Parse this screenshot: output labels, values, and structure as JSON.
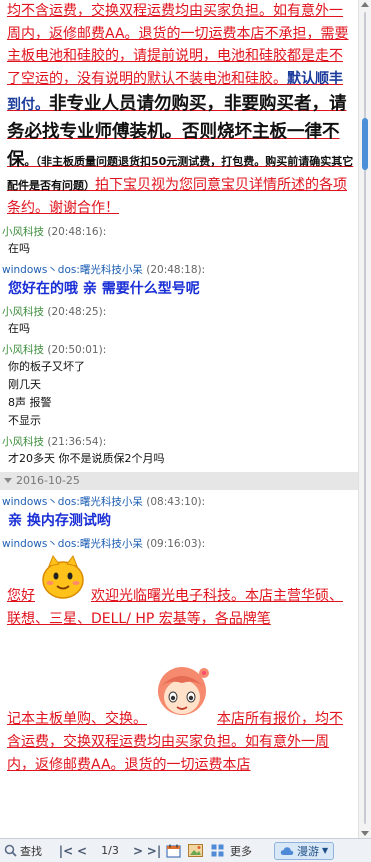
{
  "notice": {
    "p1": "均不含运费，交换双程运费均由买家负担。如有意外一周内，返修邮费AA。退货的一切运费本店不承担，需要主板电池和硅胶的，请提前说明，电池和硅胶都是走不了空运的，没有说明的默认不装电池和硅胶。",
    "p2": "默认顺丰到付。",
    "p3": "非专业人员请勿购买，非要购买者，请务必找专业师傅装机。否则烧坏主板一律不保",
    "p4": "。（非主板质量问题退货扣50元测试费，打包费。购买前请确实其它配件是否有问题）",
    "p5": "拍下宝贝视为您同意宝贝详情所述的各项条约。谢谢合作！"
  },
  "messages": [
    {
      "sender": "小风科技",
      "time": "(20:48:16):",
      "lines": [
        "在吗"
      ],
      "style": "normal",
      "color": "green"
    },
    {
      "sender": "windows丶dos:曙光科技小呆",
      "time": "(20:48:18):",
      "lines": [
        "您好在的哦  亲  需要什么型号呢"
      ],
      "style": "blue-bold",
      "color": "blue"
    },
    {
      "sender": "小风科技",
      "time": "(20:48:25):",
      "lines": [
        "在吗"
      ],
      "style": "normal",
      "color": "green"
    },
    {
      "sender": "小风科技",
      "time": "(20:50:01):",
      "lines": [
        "你的板子又坏了",
        "刚几天",
        "8声  报警",
        "不显示"
      ],
      "style": "normal",
      "color": "green"
    },
    {
      "sender": "小风科技",
      "time": "(21:36:54):",
      "lines": [
        "才20多天  你不是说质保2个月吗"
      ],
      "style": "normal",
      "color": "green"
    }
  ],
  "date_separator": "2016-10-25",
  "messages2": [
    {
      "sender": "windows丶dos:曙光科技小呆",
      "time": "(08:43:10):",
      "lines": [
        "亲  换内存测试哟"
      ],
      "style": "blue-bold",
      "color": "blue"
    },
    {
      "sender": "windows丶dos:曙光科技小呆",
      "time": "(09:16:03):"
    }
  ],
  "welcome": {
    "a": "您好",
    "b": "欢迎光临曙光电子科技。本店主营华硕、联想、三星、DELL/ HP 宏基等，各品牌笔",
    "c": "记本主板单购、交换。",
    "d": "本店所有报价，均不含运费，交换双程运费均由买家负担。如有意外一周内，返修邮费AA。退货的一切运费本店"
  },
  "toolbar": {
    "search": "查找",
    "page": "1/3",
    "more": "更多",
    "manyou": "漫游"
  },
  "icons": {
    "search": "magnifier-icon",
    "first": "first-page-icon",
    "prev": "prev-page-icon",
    "next": "next-page-icon",
    "last": "last-page-icon",
    "calendar": "calendar-icon",
    "image": "image-icon",
    "grid": "grid-icon",
    "cloud": "cloud-icon"
  },
  "colors": {
    "notice_red": "#e0141e",
    "sender_green": "#3e8f3e",
    "sender_blue": "#1e5fb3",
    "bold_blue": "#1a2fd6"
  }
}
